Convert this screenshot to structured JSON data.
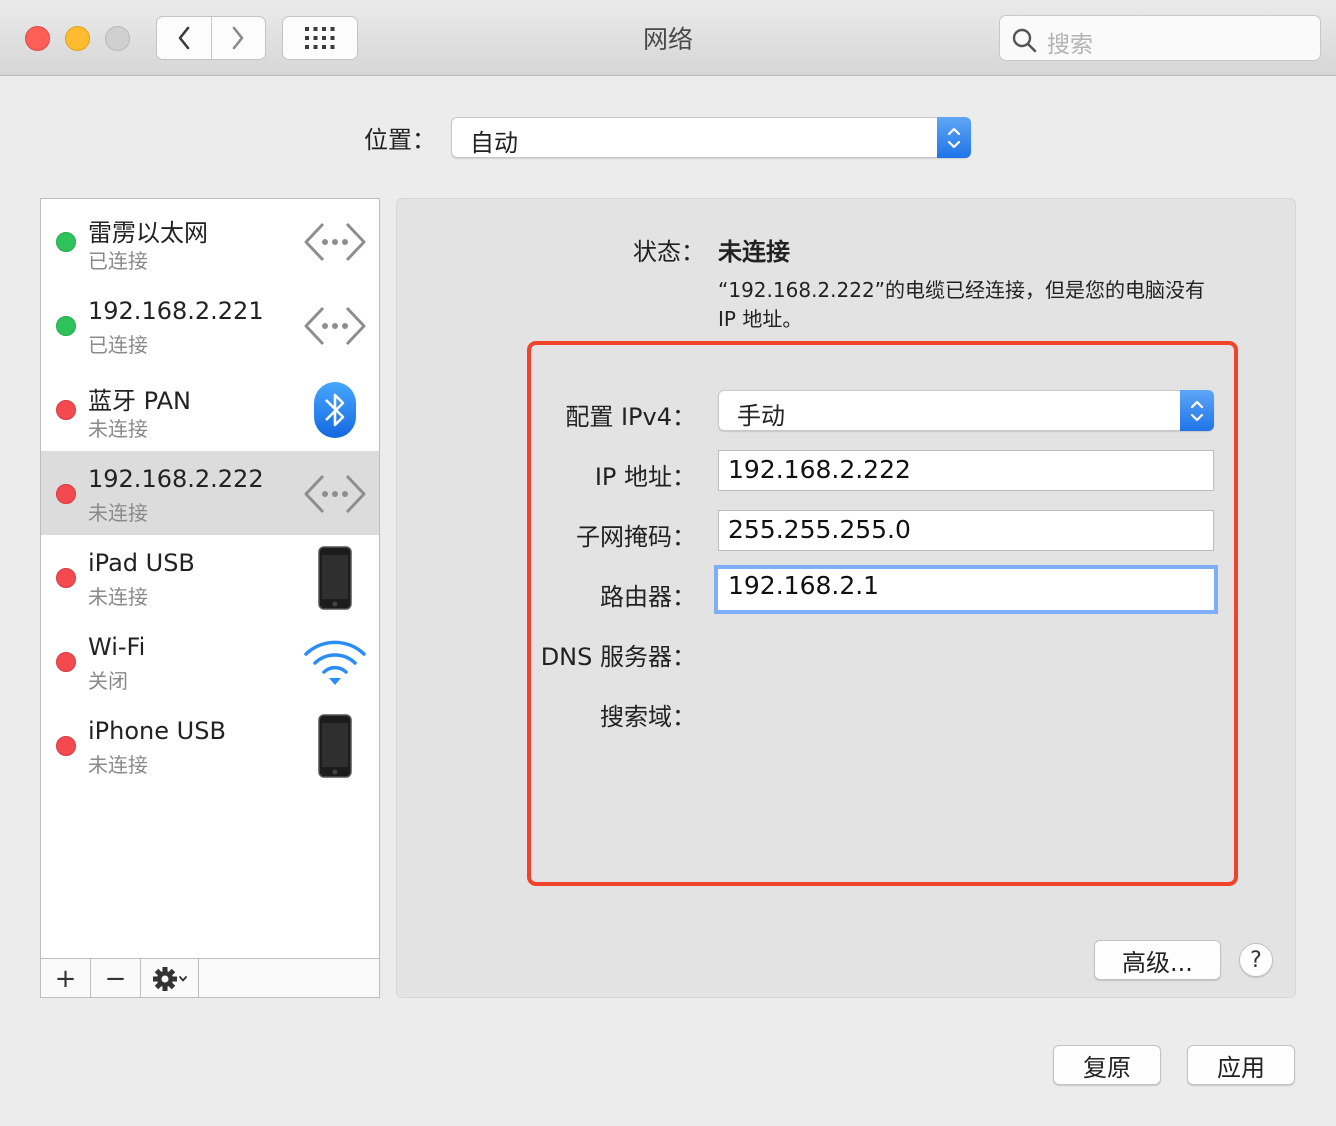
{
  "window": {
    "title": "网络"
  },
  "toolbar": {
    "back_icon": "chevron-left-icon",
    "forward_icon": "chevron-right-icon",
    "grid_icon": "grid-icon",
    "search_placeholder": "搜索"
  },
  "location": {
    "label": "位置：",
    "value": "自动"
  },
  "services": [
    {
      "name": "雷雳以太网",
      "status": "已连接",
      "status_color": "#2fc15a",
      "icon": "ethernet-icon"
    },
    {
      "name": "192.168.2.221",
      "status": "已连接",
      "status_color": "#2fc15a",
      "icon": "ethernet-icon"
    },
    {
      "name": "蓝牙 PAN",
      "status": "未连接",
      "status_color": "#f24a4f",
      "icon": "bluetooth-icon"
    },
    {
      "name": "192.168.2.222",
      "status": "未连接",
      "status_color": "#f24a4f",
      "icon": "ethernet-icon",
      "selected": true
    },
    {
      "name": "iPad USB",
      "status": "未连接",
      "status_color": "#f24a4f",
      "icon": "iphone-icon"
    },
    {
      "name": "Wi-Fi",
      "status": "关闭",
      "status_color": "#f24a4f",
      "icon": "wifi-icon"
    },
    {
      "name": "iPhone USB",
      "status": "未连接",
      "status_color": "#f24a4f",
      "icon": "iphone-icon"
    }
  ],
  "sidebar_footer": {
    "add": "+",
    "remove": "−",
    "gear_icon": "gear-icon"
  },
  "status": {
    "label": "状态：",
    "value": "未连接",
    "description": "“192.168.2.222”的电缆已经连接，但是您的电脑没有 IP 地址。"
  },
  "config": {
    "ipv4_label": "配置 IPv4：",
    "ipv4_value": "手动",
    "ip_label": "IP 地址：",
    "ip_value": "192.168.2.222",
    "subnet_label": "子网掩码：",
    "subnet_value": "255.255.255.0",
    "router_label": "路由器：",
    "router_value": "192.168.2.1",
    "dns_label": "DNS 服务器：",
    "search_domain_label": "搜索域："
  },
  "highlight_color": "#f1422a",
  "buttons": {
    "advanced": "高级...",
    "help": "?",
    "revert": "复原",
    "apply": "应用"
  }
}
